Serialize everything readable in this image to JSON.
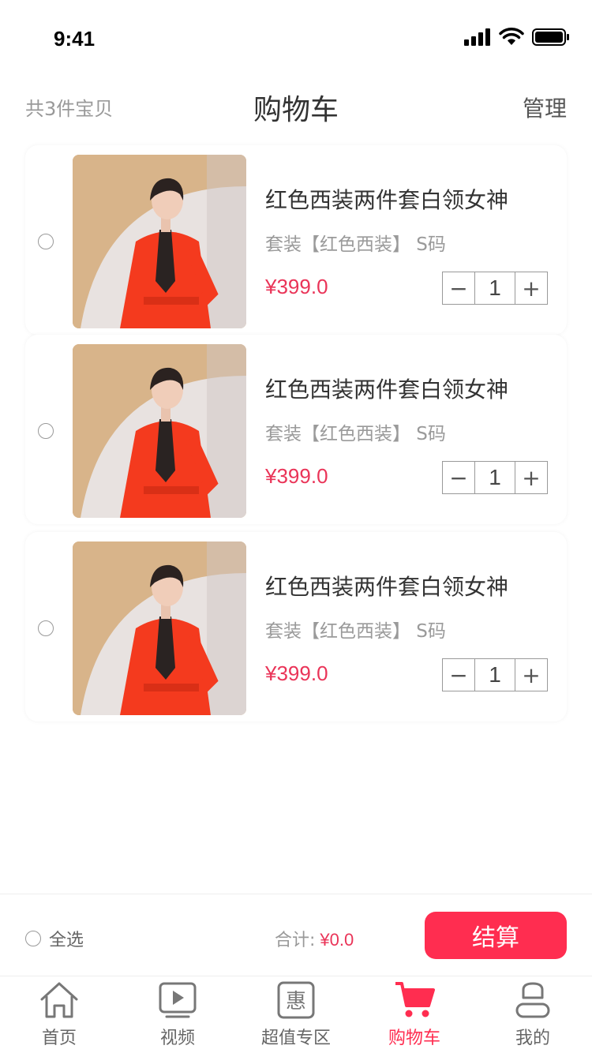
{
  "status_bar": {
    "time": "9:41"
  },
  "header": {
    "count": "共3件宝贝",
    "title": "购物车",
    "manage": "管理"
  },
  "cart": {
    "items": [
      {
        "title": "红色西装两件套白领女神",
        "spec": "套装【红色西装】 S码",
        "price": "¥399.0",
        "quantity": "1",
        "minus": "−",
        "plus": "+"
      },
      {
        "title": "红色西装两件套白领女神",
        "spec": "套装【红色西装】 S码",
        "price": "¥399.0",
        "quantity": "1",
        "minus": "−",
        "plus": "+"
      },
      {
        "title": "红色西装两件套白领女神",
        "spec": "套装【红色西装】 S码",
        "price": "¥399.0",
        "quantity": "1",
        "minus": "−",
        "plus": "+"
      }
    ]
  },
  "checkout": {
    "select_all": "全选",
    "total_label": "合计:",
    "total_value": "¥0.0",
    "button": "结算"
  },
  "tabs": [
    {
      "label": "首页",
      "icon": "home-icon"
    },
    {
      "label": "视频",
      "icon": "video-icon"
    },
    {
      "label": "超值专区",
      "icon": "deal-icon"
    },
    {
      "label": "购物车",
      "icon": "cart-icon",
      "active": true
    },
    {
      "label": "我的",
      "icon": "profile-icon"
    }
  ],
  "colors": {
    "accent": "#ff2d50",
    "price": "#ea3458"
  }
}
